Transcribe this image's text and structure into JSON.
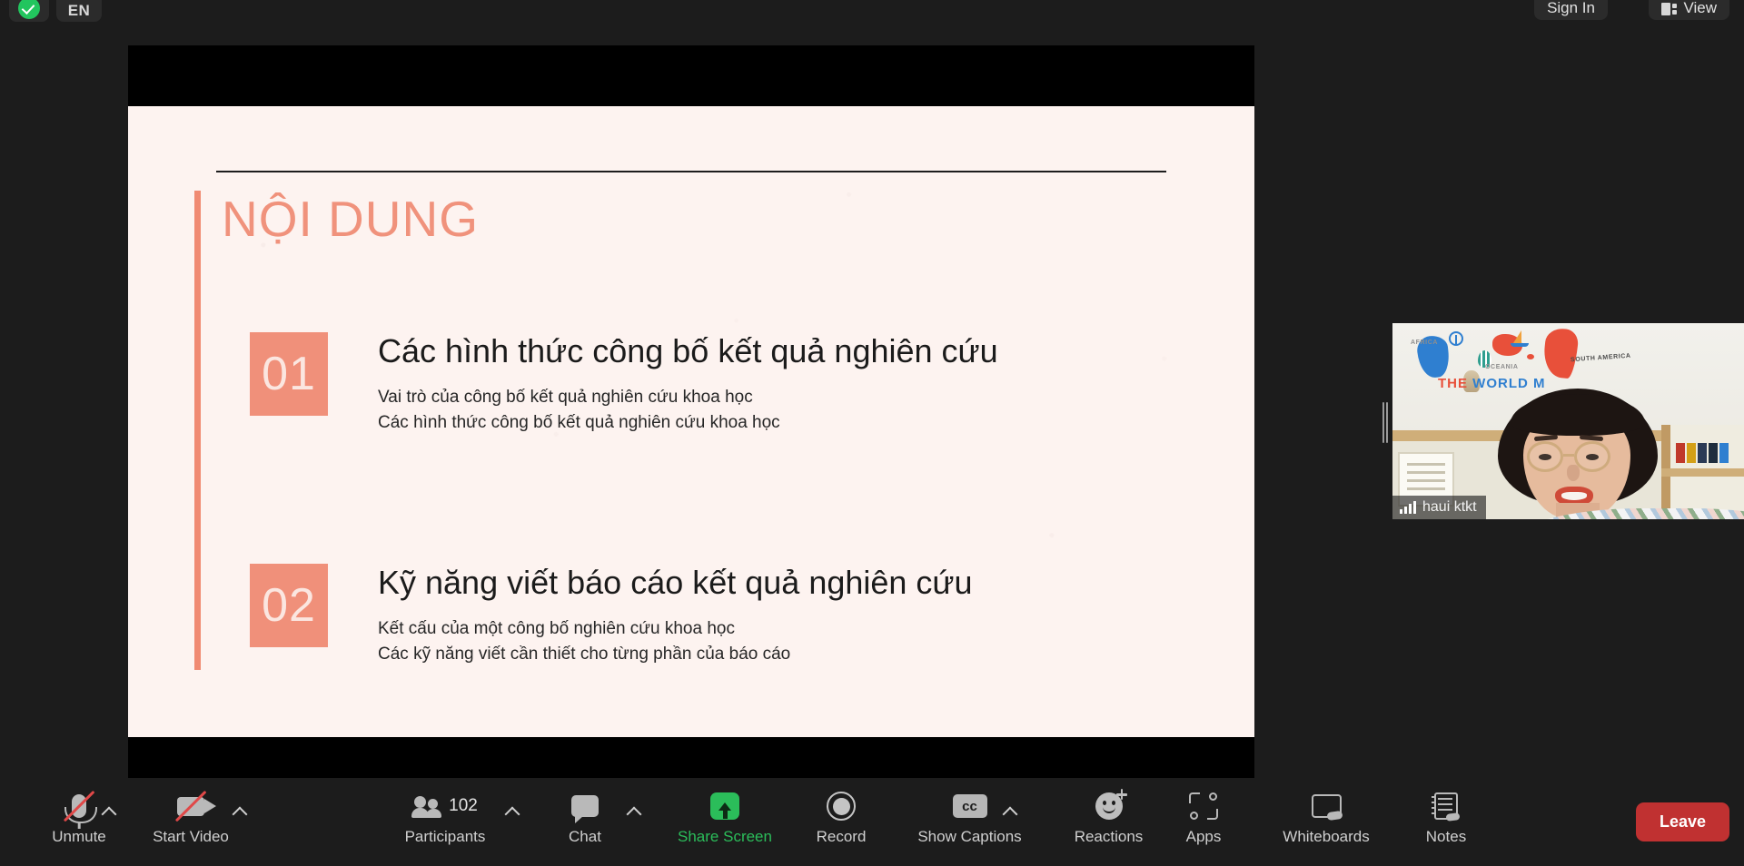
{
  "app": {
    "name": "Zoom Meeting"
  },
  "top_bar": {
    "secure_badge_icon": "shield-check-icon",
    "language_badge": "EN",
    "sign_in_label": "Sign In",
    "view_label": "View",
    "view_icon": "layout-view-icon"
  },
  "shared_screen": {
    "slide": {
      "title": "NỘI DUNG",
      "accent_color": "#f0907a",
      "background_color": "#fdf3f0",
      "rows": [
        {
          "number": "01",
          "title": "Các hình thức công bố kết quả nghiên cứu",
          "subitems": [
            "Vai trò của công bố kết quả nghiên cứu khoa học",
            "Các hình thức công bố kết quả nghiên cứu khoa học"
          ]
        },
        {
          "number": "02",
          "title": "Kỹ năng viết báo cáo kết quả nghiên cứu",
          "subitems": [
            "Kết cấu của một công bố nghiên cứu khoa học",
            "Các kỹ năng viết cần thiết cho từng phần của báo cáo"
          ]
        }
      ]
    }
  },
  "video_tile": {
    "participant_name": "haui ktkt",
    "signal_icon": "signal-bars-icon",
    "background_wall_words": {
      "africa": "AFRICA",
      "oceania": "OCEANIA",
      "south_america": "SOUTH AMERICA",
      "the_world": "THE",
      "the_world_2": "WORLD M"
    }
  },
  "toolbar": {
    "items": [
      {
        "label": "Unmute",
        "icon": "microphone-muted-icon",
        "has_chevron": true,
        "state": "muted"
      },
      {
        "label": "Start Video",
        "icon": "camera-off-icon",
        "has_chevron": true,
        "state": "video-off"
      },
      {
        "label": "Participants",
        "icon": "participants-icon",
        "has_chevron": true,
        "count": "102"
      },
      {
        "label": "Chat",
        "icon": "chat-bubble-icon",
        "has_chevron": true
      },
      {
        "label": "Share Screen",
        "icon": "share-screen-icon",
        "has_chevron": false,
        "state": "active",
        "color": "#2bbd5a"
      },
      {
        "label": "Record",
        "icon": "record-circle-icon",
        "has_chevron": false
      },
      {
        "label": "Show Captions",
        "icon": "closed-captions-icon",
        "has_chevron": true
      },
      {
        "label": "Reactions",
        "icon": "reactions-smiley-icon",
        "has_chevron": false
      },
      {
        "label": "Apps",
        "icon": "apps-icon",
        "has_chevron": false
      },
      {
        "label": "Whiteboards",
        "icon": "whiteboard-icon",
        "has_chevron": false
      },
      {
        "label": "Notes",
        "icon": "notes-icon",
        "has_chevron": false
      }
    ],
    "leave_label": "Leave",
    "leave_color": "#c03131"
  }
}
